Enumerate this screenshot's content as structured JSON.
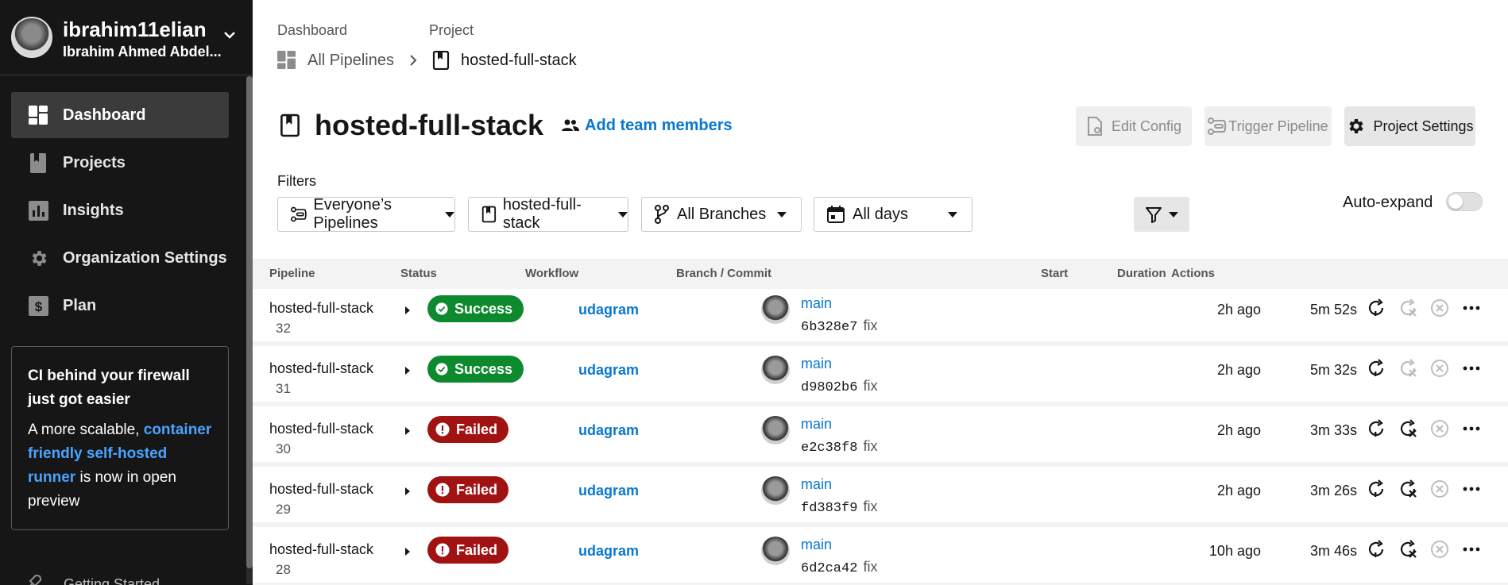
{
  "user": {
    "username": "ibrahim11elian",
    "full_name": "Ibrahim Ahmed Abdel..."
  },
  "nav": [
    {
      "label": "Dashboard",
      "icon": "dashboard-icon",
      "active": true
    },
    {
      "label": "Projects",
      "icon": "projects-icon",
      "active": false
    },
    {
      "label": "Insights",
      "icon": "insights-icon",
      "active": false
    },
    {
      "label": "Organization Settings",
      "icon": "gear-icon",
      "active": false
    },
    {
      "label": "Plan",
      "icon": "dollar-icon",
      "active": false
    }
  ],
  "promo": {
    "title": "CI behind your firewall just got easier",
    "body_start": "A more scalable,",
    "link": "container friendly self-hosted runner",
    "body_end": "is now in open preview"
  },
  "getting_started": "Getting Started",
  "breadcrumb": {
    "label1": "Dashboard",
    "label2": "Project",
    "item1": "All Pipelines",
    "item2": "hosted-full-stack"
  },
  "page": {
    "title": "hosted-full-stack",
    "add_team": "Add team members"
  },
  "buttons": {
    "edit_config": "Edit Config",
    "trigger_pipeline": "Trigger Pipeline",
    "project_settings": "Project Settings"
  },
  "filters": {
    "label": "Filters",
    "pipelines": "Everyone’s Pipelines",
    "project": "hosted-full-stack",
    "branches": "All Branches",
    "days": "All days",
    "auto_expand": "Auto-expand"
  },
  "table": {
    "headers": {
      "pipeline": "Pipeline",
      "status": "Status",
      "workflow": "Workflow",
      "branch_commit": "Branch / Commit",
      "start": "Start",
      "duration": "Duration",
      "actions": "Actions"
    },
    "rows": [
      {
        "name": "hosted-full-stack",
        "number": "32",
        "status": "Success",
        "workflow": "udagram",
        "branch": "main",
        "hash": "6b328e7",
        "message": "fix",
        "start": "2h ago",
        "duration": "5m 52s"
      },
      {
        "name": "hosted-full-stack",
        "number": "31",
        "status": "Success",
        "workflow": "udagram",
        "branch": "main",
        "hash": "d9802b6",
        "message": "fix",
        "start": "2h ago",
        "duration": "5m 32s"
      },
      {
        "name": "hosted-full-stack",
        "number": "30",
        "status": "Failed",
        "workflow": "udagram",
        "branch": "main",
        "hash": "e2c38f8",
        "message": "fix",
        "start": "2h ago",
        "duration": "3m 33s"
      },
      {
        "name": "hosted-full-stack",
        "number": "29",
        "status": "Failed",
        "workflow": "udagram",
        "branch": "main",
        "hash": "fd383f9",
        "message": "fix",
        "start": "2h ago",
        "duration": "3m 26s"
      },
      {
        "name": "hosted-full-stack",
        "number": "28",
        "status": "Failed",
        "workflow": "udagram",
        "branch": "main",
        "hash": "6d2ca42",
        "message": "fix",
        "start": "10h ago",
        "duration": "3m 46s"
      }
    ]
  },
  "colors": {
    "success": "#0e8a2e",
    "failed": "#a11212",
    "link": "#0878cf",
    "sidebar": "#161616"
  }
}
